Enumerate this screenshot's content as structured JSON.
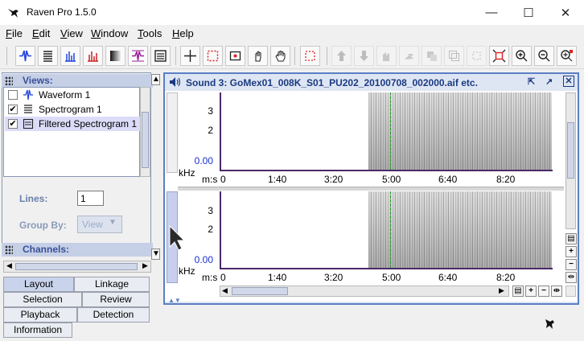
{
  "window": {
    "title": "Raven Pro 1.5.0"
  },
  "menu": [
    {
      "label": "File",
      "underline": "F",
      "rest": "ile"
    },
    {
      "label": "Edit",
      "underline": "E",
      "rest": "dit"
    },
    {
      "label": "View",
      "underline": "V",
      "rest": "iew"
    },
    {
      "label": "Window",
      "underline": "W",
      "rest": "indow"
    },
    {
      "label": "Tools",
      "underline": "T",
      "rest": "ools"
    },
    {
      "label": "Help",
      "underline": "H",
      "rest": "elp"
    }
  ],
  "views_panel": {
    "title": "Views:",
    "items": [
      {
        "label": "Waveform 1",
        "checked": false,
        "icon": "waveform-icon"
      },
      {
        "label": "Spectrogram 1",
        "checked": true,
        "icon": "spectrogram-icon"
      },
      {
        "label": "Filtered Spectrogram 1",
        "checked": true,
        "icon": "filtered-spectrogram-icon",
        "selected": true
      }
    ],
    "lines_label": "Lines:",
    "lines_value": "1",
    "group_by_label": "Group By:",
    "group_by_value": "View"
  },
  "channels_panel": {
    "title": "Channels:"
  },
  "tabs": {
    "layout": "Layout",
    "linkage": "Linkage",
    "selection": "Selection",
    "review": "Review",
    "playback": "Playback",
    "detection": "Detection",
    "information": "Information"
  },
  "sound_window": {
    "title": "Sound 3: GoMex01_008K_S01_PU202_20100708_002000.aif etc."
  },
  "plot": {
    "y_ticks": [
      "3",
      "2",
      "0.00"
    ],
    "y_unit": "kHz",
    "x_unit": "m:s",
    "x_ticks": [
      "0",
      "1:40",
      "3:20",
      "5:00",
      "6:40",
      "8:20"
    ]
  },
  "colors": {
    "accent": "#5a7fc4",
    "axis": "#4a2a6a",
    "cursor_line": "#1a9a1a"
  }
}
